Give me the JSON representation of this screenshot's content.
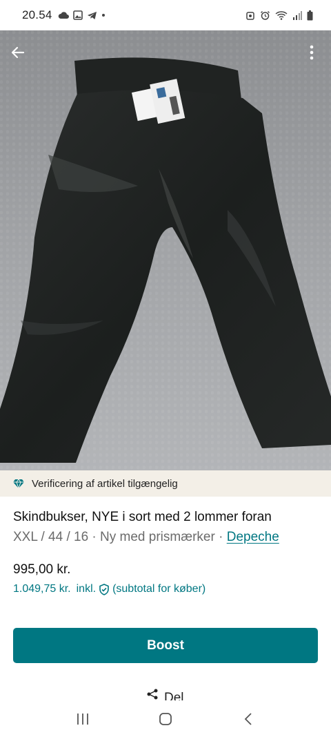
{
  "status_bar": {
    "time": "20.54",
    "left_icons": [
      "cloud-icon",
      "image-icon",
      "telegram-icon",
      "dot-icon"
    ],
    "right_icons": [
      "alarm-icon",
      "alarm-clock-icon",
      "wifi-icon",
      "signal-icon",
      "battery-icon"
    ]
  },
  "photo": {
    "back_icon": "arrow-left-icon",
    "more_icon": "more-vertical-icon"
  },
  "verification": {
    "icon": "diamond-icon",
    "text": "Verificering af artikel tilgængelig"
  },
  "item": {
    "title": "Skindbukser, NYE i sort med 2 lommer foran",
    "meta_prefix": "XXL / 44 / 16 · Ny med prismærker · ",
    "brand": "Depeche",
    "price": "995,00 kr.",
    "buyer_price": "1.049,75 kr.",
    "buyer_incl": "inkl.",
    "buyer_note": "(subtotal for køber)"
  },
  "actions": {
    "boost_label": "Boost",
    "share_label": "Del"
  },
  "nav_bar": {
    "icons": [
      "recent-apps-icon",
      "home-icon",
      "back-icon"
    ]
  },
  "colors": {
    "accent": "#007782",
    "banner_bg": "#f3efe7"
  }
}
